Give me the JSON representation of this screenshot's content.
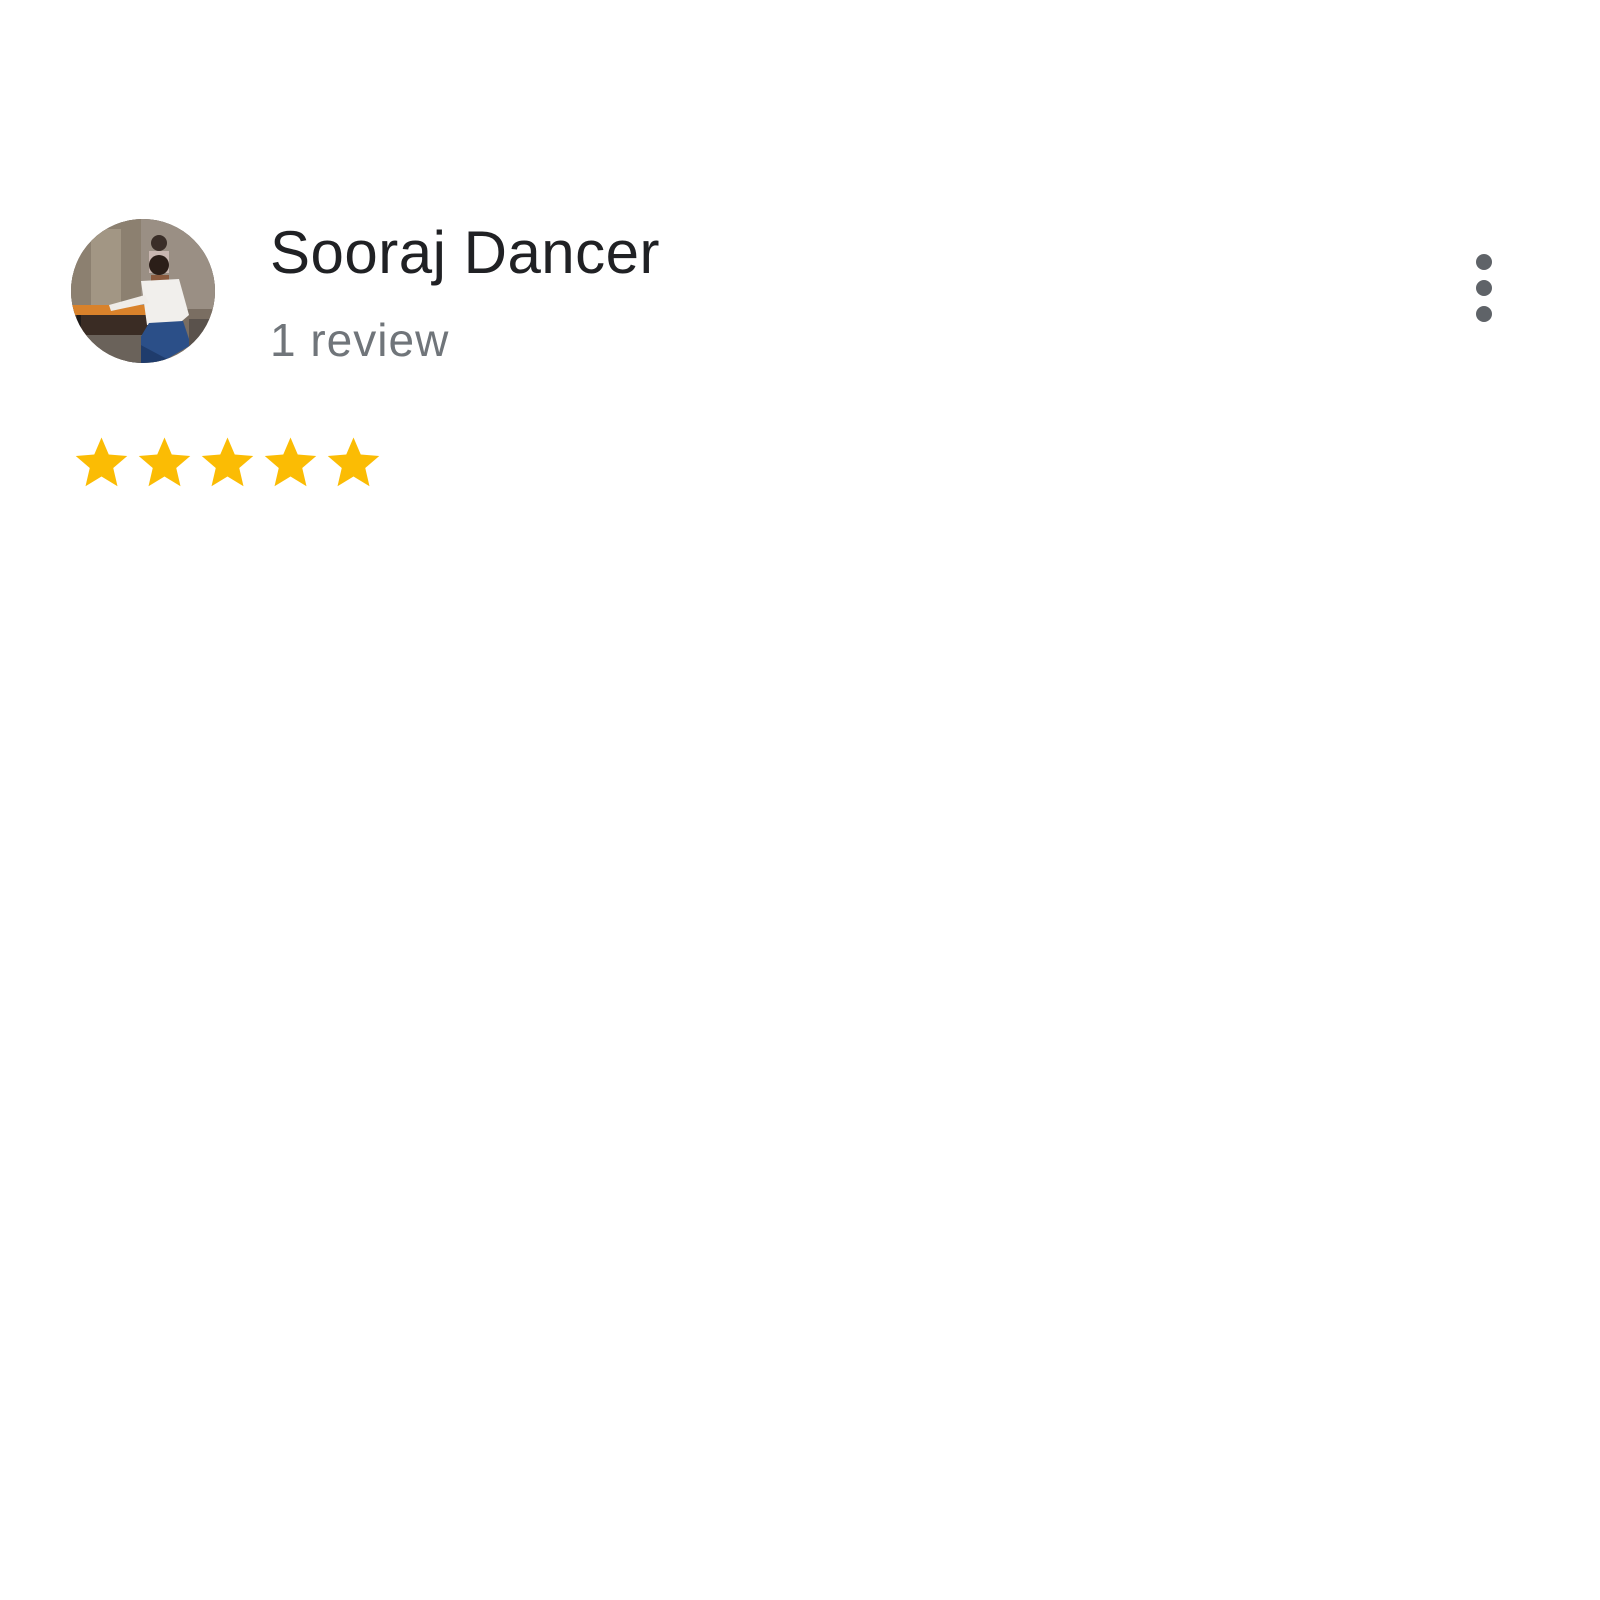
{
  "review": {
    "reviewer_name": "Sooraj Dancer",
    "review_count": "1 review",
    "avatar_alt": "Sooraj Dancer profile photo",
    "more_options_icon": "more-vert-icon",
    "rating": 5,
    "max_rating": 5,
    "star_color": "#fbbc04"
  },
  "colors": {
    "name_text": "#202124",
    "secondary_text": "#70757a",
    "icon": "#5f6368"
  }
}
